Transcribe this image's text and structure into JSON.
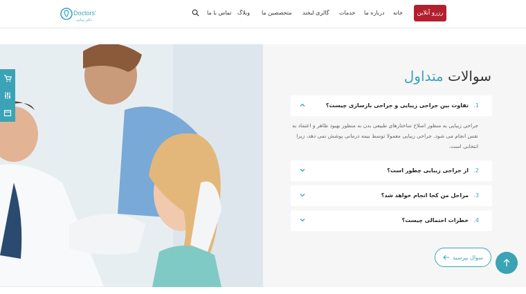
{
  "header": {
    "logo_text": "Doctors' دکتر زیبایی",
    "reserve_label": "رزرو آنلاین",
    "nav": [
      {
        "label": "خانه"
      },
      {
        "label": "درباره ما"
      },
      {
        "label": "خدمات"
      },
      {
        "label": "گالری لبخند"
      },
      {
        "label": "متخصصین ما"
      },
      {
        "label": "وبلاگ"
      },
      {
        "label": "تماس با ما"
      }
    ],
    "search_icon": "search-icon"
  },
  "faq": {
    "title_main": "سوالات",
    "title_accent": "متداول",
    "items": [
      {
        "num": ".1",
        "question": "تفاوت بین جراحی زیبایی و جراحی بازسازی چیست؟",
        "expanded": true,
        "answer": "جراحی زیبایی به منظور اصلاح ساختارهای طبیعی بدن به منظور بهبود ظاهر و اعتماد به نفس انجام می شود. جراحی زیبایی معمولا توسط بیمه درمانی پوشش نمی دهد، زیرا انتخابی است."
      },
      {
        "num": ".2",
        "question": "از جراحی زیبایی چطور است؟",
        "expanded": false
      },
      {
        "num": ".3",
        "question": "مراحل من کجا انجام خواهد شد؟",
        "expanded": false
      },
      {
        "num": ".4",
        "question": "خطرات احتمالی چیست؟",
        "expanded": false
      }
    ],
    "ask_label": "سوال بپرسید"
  },
  "colors": {
    "accent": "#3aa3b6",
    "brand_red": "#b21f2d",
    "panel_bg": "#f6f6f6"
  },
  "side_tools": [
    "cart-icon",
    "sliders-icon",
    "calendar-icon"
  ],
  "scroll_top_icon": "arrow-up-icon"
}
